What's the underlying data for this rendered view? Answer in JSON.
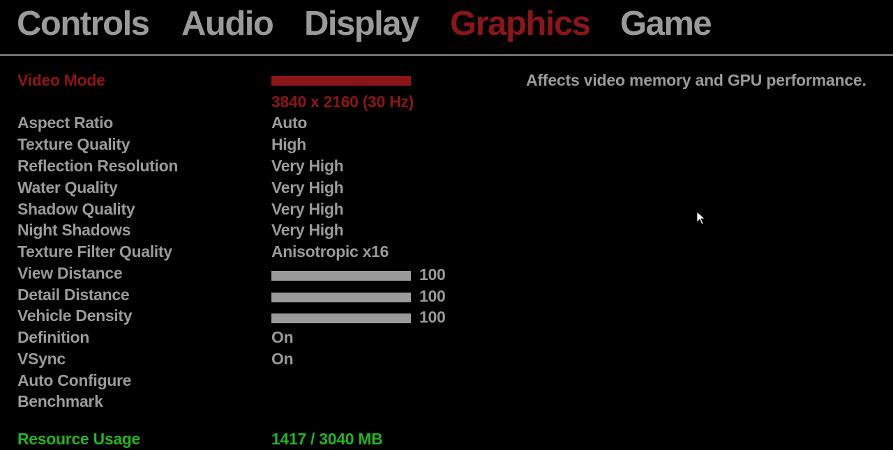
{
  "tabs": [
    {
      "label": "Controls",
      "active": false
    },
    {
      "label": "Audio",
      "active": false
    },
    {
      "label": "Display",
      "active": false
    },
    {
      "label": "Graphics",
      "active": true
    },
    {
      "label": "Game",
      "active": false
    }
  ],
  "settings": {
    "video_mode": {
      "label": "Video Mode",
      "value": "3840 x 2160 (30 Hz)",
      "slider_fraction": 1.0
    },
    "aspect_ratio": {
      "label": "Aspect Ratio",
      "value": "Auto"
    },
    "texture_quality": {
      "label": "Texture Quality",
      "value": "High"
    },
    "reflection_resolution": {
      "label": "Reflection Resolution",
      "value": "Very High"
    },
    "water_quality": {
      "label": "Water Quality",
      "value": "Very High"
    },
    "shadow_quality": {
      "label": "Shadow Quality",
      "value": "Very High"
    },
    "night_shadows": {
      "label": "Night Shadows",
      "value": "Very High"
    },
    "texture_filter_quality": {
      "label": "Texture Filter Quality",
      "value": "Anisotropic x16"
    },
    "view_distance": {
      "label": "View Distance",
      "value": "100",
      "max": 100
    },
    "detail_distance": {
      "label": "Detail Distance",
      "value": "100",
      "max": 100
    },
    "vehicle_density": {
      "label": "Vehicle Density",
      "value": "100",
      "max": 100
    },
    "definition": {
      "label": "Definition",
      "value": "On"
    },
    "vsync": {
      "label": "VSync",
      "value": "On"
    },
    "auto_configure": {
      "label": "Auto Configure"
    },
    "benchmark": {
      "label": "Benchmark"
    }
  },
  "resource_usage": {
    "label": "Resource Usage",
    "value": "1417 / 3040 MB"
  },
  "help_text": "Affects video memory and GPU performance.",
  "colors": {
    "text": "#9a9a9a",
    "selected": "#8b1518",
    "resource": "#22b322",
    "background": "#000000"
  },
  "cursor": {
    "icon": "mouse-pointer-icon"
  }
}
